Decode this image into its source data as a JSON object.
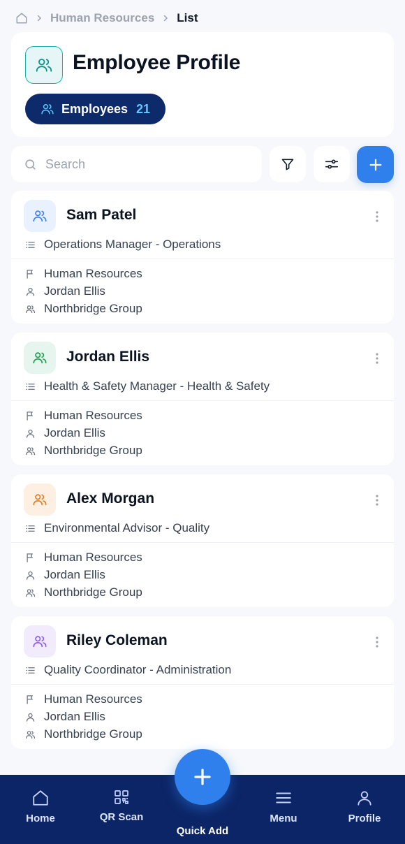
{
  "breadcrumb": {
    "items": [
      "Human Resources"
    ],
    "current": "List"
  },
  "header": {
    "title": "Employee Profile",
    "pill_label": "Employees",
    "pill_count": "21"
  },
  "search": {
    "placeholder": "Search",
    "value": ""
  },
  "colors": {
    "primary": "#2f80ed",
    "navy": "#0c2566",
    "pill_count": "#5ec8ff"
  },
  "employees": [
    {
      "name": "Sam Patel",
      "role": "Operations Manager - Operations",
      "department": "Human Resources",
      "manager": "Jordan Ellis",
      "group": "Northbridge Group",
      "avatar_bg": "#e8f1fd",
      "avatar_fg": "#3b82f6"
    },
    {
      "name": "Jordan Ellis",
      "role": "Health & Safety Manager - Health & Safety",
      "department": "Human Resources",
      "manager": "Jordan Ellis",
      "group": "Northbridge Group",
      "avatar_bg": "#e6f6ee",
      "avatar_fg": "#16a34a"
    },
    {
      "name": "Alex Morgan",
      "role": "Environmental Advisor - Quality",
      "department": "Human Resources",
      "manager": "Jordan Ellis",
      "group": "Northbridge Group",
      "avatar_bg": "#fdf0e3",
      "avatar_fg": "#ea7a1c"
    },
    {
      "name": "Riley Coleman",
      "role": "Quality Coordinator - Administration",
      "department": "Human Resources",
      "manager": "Jordan Ellis",
      "group": "Northbridge Group",
      "avatar_bg": "#f1ebfb",
      "avatar_fg": "#8b5cf6"
    }
  ],
  "nav": {
    "home": "Home",
    "qr": "QR Scan",
    "quick_add": "Quick Add",
    "menu": "Menu",
    "profile": "Profile"
  }
}
